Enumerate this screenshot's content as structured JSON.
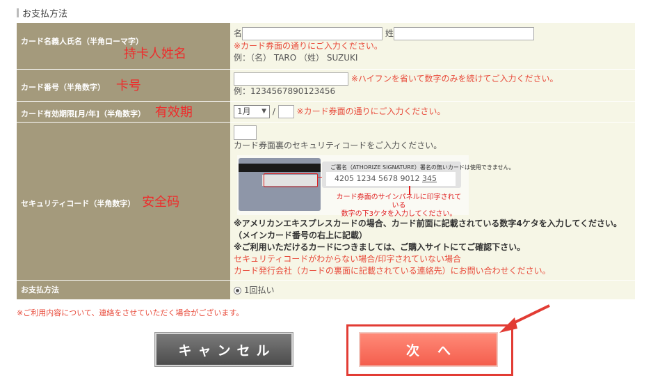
{
  "section": {
    "title": "お支払方法"
  },
  "rows": {
    "name": {
      "label": "カード名義人氏名（半角ローマ字）",
      "annotation": "持卡人姓名",
      "first_label": "名",
      "last_label": "姓",
      "first_value": "",
      "last_value": "",
      "hint": "※カード券面の通りにご入力ください。",
      "example": "例：（名） TARO （姓） SUZUKI"
    },
    "number": {
      "label": "カード番号（半角数字）",
      "annotation": "卡号",
      "value": "",
      "hint": "※ハイフンを省いて数字のみを続けてご入力ください。",
      "example": "例：1234567890123456"
    },
    "expiry": {
      "label": "カード有効期限[月/年]（半角数字）",
      "annotation": "有效期",
      "month": "1月",
      "separator": "/",
      "year": "",
      "hint": "※カード券面の通りにご入力ください。"
    },
    "security": {
      "label": "セキュリティコード（半角数字）",
      "annotation": "安全码",
      "value": "",
      "instruction": "カード券面裏のセキュリティコードをご入力ください。",
      "image": {
        "panel_caption": "ご署名（ATHORIZE SIGNATURE）署名の無いカードは使用できません。",
        "card_number": "4205 1234 5678 9012",
        "code": "345",
        "caption_line1": "カード券面のサインパネルに印字されている",
        "caption_line2": "数字の下3ケタを入力してください。"
      },
      "amex_note": "※アメリカンエキスプレスカードの場合、カード前面に記載されている数字4ケタを入力してください。",
      "amex_note2": "（メインカード番号の右上に記載）",
      "card_note": "※ご利用いただけるカードにつきましては、ご購入サイトにてご確認下さい。",
      "unknown_note": "セキュリティコードがわからない場合/印字されていない場合",
      "contact_note": "カード発行会社（カードの裏面に記載されている連絡先）にお問い合わせください。"
    },
    "payment": {
      "label": "お支払方法",
      "option": "1回払い",
      "selected": true
    }
  },
  "notice": "※ご利用内容について、連絡をさせていただく場合がございます。",
  "buttons": {
    "cancel": "キャンセル",
    "next": "次へ"
  },
  "colors": {
    "label_bg": "#a49a7c",
    "value_bg": "#f6f6e6",
    "accent_red": "#e84a3a",
    "annotation_red": "#ee2b2b",
    "cancel_bg": "#5f5f5f",
    "next_bg": "#f8735f"
  }
}
